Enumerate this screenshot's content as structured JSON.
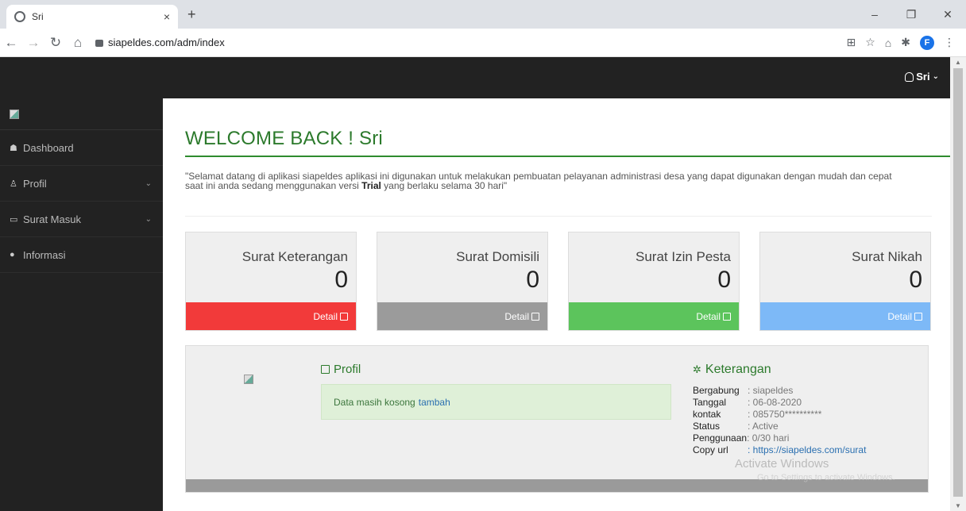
{
  "browser": {
    "tab_title": "Sri",
    "tab_close": "×",
    "new_tab": "+",
    "url": "siapeldes.com/adm/index",
    "profile_initial": "F"
  },
  "topbar": {
    "user_label": "Sri"
  },
  "sidebar": {
    "items": [
      {
        "label": "Dashboard",
        "icon": "home-icon",
        "has_chevron": false
      },
      {
        "label": "Profil",
        "icon": "user-icon",
        "has_chevron": true
      },
      {
        "label": "Surat Masuk",
        "icon": "inbox-icon",
        "has_chevron": true
      },
      {
        "label": "Informasi",
        "icon": "info-icon",
        "has_chevron": false
      }
    ]
  },
  "main": {
    "welcome": "WELCOME BACK ! Sri",
    "intro_line1": "\"Selamat datang di aplikasi siapeldes aplikasi ini digunakan untuk melakukan pembuatan pelayanan administrasi desa yang dapat digunakan dengan mudah dan cepat",
    "intro_line2_a": "saat ini anda sedang menggunakan versi ",
    "intro_line2_bold": "Trial",
    "intro_line2_b": " yang berlaku selama 30 hari\"",
    "cards": [
      {
        "title": "Surat Keterangan",
        "count": "0",
        "detail": "Detail",
        "color": "#f23a3a"
      },
      {
        "title": "Surat Domisili",
        "count": "0",
        "detail": "Detail",
        "color": "#9b9b9b"
      },
      {
        "title": "Surat Izin Pesta",
        "count": "0",
        "detail": "Detail",
        "color": "#5cc45c"
      },
      {
        "title": "Surat Nikah",
        "count": "0",
        "detail": "Detail",
        "color": "#7db9f7"
      }
    ],
    "profile": {
      "heading": "Profil",
      "empty_text": "Data masih kosong",
      "add_link": "tambah"
    },
    "keterangan": {
      "heading": "Keterangan",
      "rows": [
        {
          "key": "Bergabung",
          "val": ": siapeldes"
        },
        {
          "key": "Tanggal",
          "val": ": 06-08-2020"
        },
        {
          "key": "kontak",
          "val": ": 085750**********"
        },
        {
          "key": "Status",
          "val": ": Active"
        },
        {
          "key": "Penggunaan",
          "val": ": 0/30 hari"
        },
        {
          "key": "Copy url",
          "val": ": https://siapeldes.com/surat"
        }
      ]
    }
  },
  "watermark": {
    "line1": "Activate Windows",
    "line2": "Go to Settings to activate Windows."
  }
}
